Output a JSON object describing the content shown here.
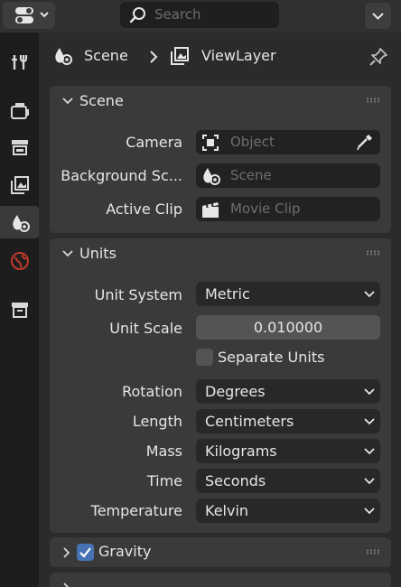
{
  "header": {
    "search_placeholder": "Search"
  },
  "tabs": [
    {
      "icon": "tool-icon"
    },
    {
      "icon": "render-icon"
    },
    {
      "icon": "output-icon"
    },
    {
      "icon": "view-layer-icon"
    },
    {
      "icon": "scene-icon",
      "active": true
    },
    {
      "icon": "world-icon"
    },
    {
      "icon": "collection-icon"
    }
  ],
  "breadcrumb": {
    "scene": "Scene",
    "view_layer": "ViewLayer"
  },
  "scene_panel": {
    "title": "Scene",
    "camera_label": "Camera",
    "camera_value": "Object",
    "background_label": "Background Sc...",
    "background_value": "Scene",
    "clip_label": "Active Clip",
    "clip_value": "Movie Clip"
  },
  "units_panel": {
    "title": "Units",
    "unit_system_label": "Unit System",
    "unit_system_value": "Metric",
    "unit_scale_label": "Unit Scale",
    "unit_scale_value": "0.010000",
    "separate_units_label": "Separate Units",
    "separate_units_checked": false,
    "rotation_label": "Rotation",
    "rotation_value": "Degrees",
    "length_label": "Length",
    "length_value": "Centimeters",
    "mass_label": "Mass",
    "mass_value": "Kilograms",
    "time_label": "Time",
    "time_value": "Seconds",
    "temperature_label": "Temperature",
    "temperature_value": "Kelvin"
  },
  "gravity_panel": {
    "title": "Gravity",
    "checked": true
  },
  "colors": {
    "accent": "#4772b3",
    "panel": "#3a3a3a",
    "background": "#2b2b2b"
  }
}
